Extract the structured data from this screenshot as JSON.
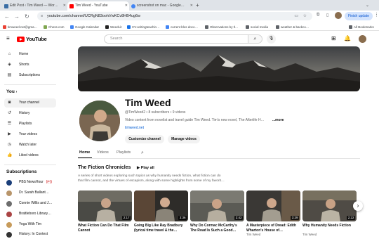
{
  "browser": {
    "tabs": [
      {
        "label": "Edit Post ‹ Tim Weed — Wor…",
        "active": false
      },
      {
        "label": "Tim Weed - YouTube",
        "active": true
      },
      {
        "label": "screenshot on mac - Google…",
        "active": false
      }
    ],
    "url": "youtube.com/channel/UCRgN83oohVwKCv8HB4ug6w",
    "finish_update": "Finish update",
    "bookmarks": [
      "timweed.net@gma…",
      "Chess.com",
      "Google Calendar",
      "WeedLit",
      "CV-writingteachin…",
      "current blos doco…",
      "Observations by tl…",
      "social media",
      "weather & backco…"
    ],
    "all_bookmarks": "All Bookmarks"
  },
  "youtube": {
    "logo_text": "YouTube",
    "search_placeholder": "Search",
    "sidebar": {
      "main": [
        "Home",
        "Shorts",
        "Subscriptions"
      ],
      "you_heading": "You",
      "you_items": [
        "Your channel",
        "History",
        "Playlists",
        "Your videos",
        "Watch later",
        "Liked videos"
      ],
      "subscriptions_heading": "Subscriptions",
      "subscriptions": [
        "PBS NewsHour",
        "Dr. Sarah Ballant…",
        "Connie Willis and J…",
        "Brattleboro Library…",
        "Yoga With Tim",
        "History: In Context"
      ]
    },
    "channel": {
      "name": "Tim Weed",
      "meta": "@TimWeed2 • 8 subscribers • 9 videos",
      "description": "Video content from novelist and travel guide Tim Weed. Tim's new novel, The Afterlife H…",
      "more_link": "...more",
      "website": "timweed.net",
      "customize_button": "Customize channel",
      "manage_button": "Manage videos",
      "tabs": [
        "Home",
        "Videos",
        "Playlists"
      ]
    },
    "playlist": {
      "title": "The Fiction Chronicles",
      "play_all": "Play all",
      "description_line1": "A series of short videos exploring such topics as why humanity needs fiction, what fiction can do",
      "description_line2": "that film cannot, and the virtues of escapism, along with some highlights from some of my favorit…",
      "videos": [
        {
          "title": "What Fiction Can Do That Film Cannot",
          "duration": "2:17",
          "meta": ""
        },
        {
          "title": "Going Big Like Ray Bradbury (lyrical time travel & the…",
          "duration": "3:36",
          "meta": ""
        },
        {
          "title": "Why Do Cormac McCarthy's The Road Is Such a Good…",
          "duration": "2:42",
          "meta": ""
        },
        {
          "title": "A Masterpiece of Dread: Edith Wharton's House of…",
          "duration": "3:29",
          "meta": "Tim Weed"
        },
        {
          "title": "Why Humanity Needs Fiction",
          "duration": "2:22",
          "meta": "Tim Weed"
        }
      ]
    }
  },
  "colors": {
    "youtube_red": "#ff0000",
    "accent": "#065fd4"
  }
}
